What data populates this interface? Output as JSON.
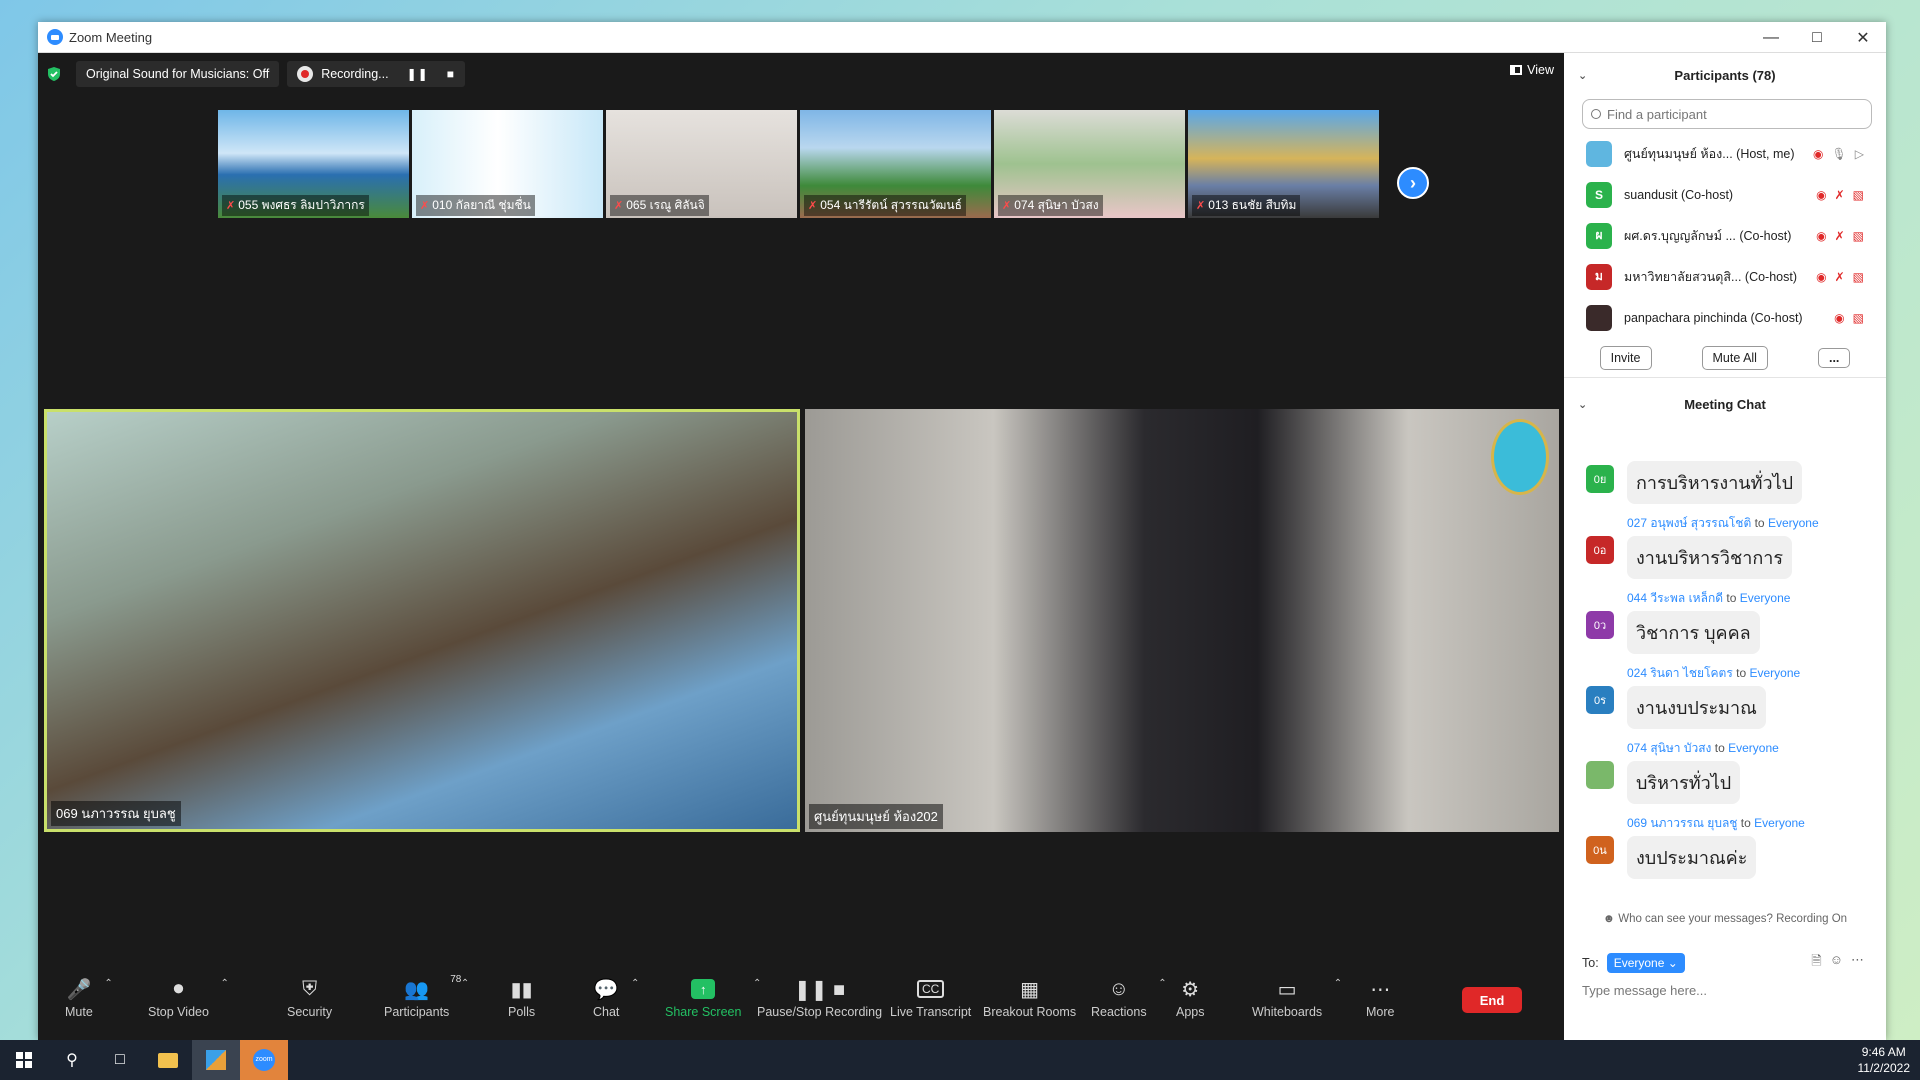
{
  "window": {
    "title": "Zoom Meeting"
  },
  "topbar": {
    "sound_label": "Original Sound for Musicians: Off",
    "recording_label": "Recording...",
    "view_label": "View"
  },
  "thumbnails": [
    {
      "name": "055 พงศธร ลิมปาวิภากร",
      "bg": "linear-gradient(180deg,#6fb6e8 0%,#cfe6f7 40%,#2a6fb0 60%,#4a8a3a 100%)"
    },
    {
      "name": "010 กัลยาณี ชุ่มชื่น",
      "bg": "linear-gradient(90deg,#d8f0fa 0%,#ffffff 45%,#c8e8f8 100%)"
    },
    {
      "name": "065 เรณู ศิลันจิ",
      "bg": "linear-gradient(180deg,#e6e2de 0%,#c9c2bc 100%)"
    },
    {
      "name": "054 นารีรัตน์ สุวรรณวัฒนธ์",
      "bg": "linear-gradient(180deg,#7fb6e6 0%,#b9d7ef 35%,#3e8a3a 70%,#9b6b4e 100%)"
    },
    {
      "name": "074 สุนิษา บัวสง",
      "bg": "linear-gradient(180deg,#dcdcd6 0%,#9ec28f 50%,#e9c6c8 100%)"
    },
    {
      "name": "013 ธนชัย สืบทิม",
      "bg": "linear-gradient(180deg,#5aa7e8 0%,#d6b45a 45%,#6a7fa6 70%,#3a3a3a 100%)"
    }
  ],
  "speaker_left": {
    "name": "069 นภาวรรณ ยุบลชู"
  },
  "speaker_right": {
    "name": "ศูนย์ทุนมนุษย์ ห้อง202"
  },
  "toolbar": {
    "mute": "Mute",
    "stop_video": "Stop Video",
    "security": "Security",
    "participants": "Participants",
    "participants_count": "78",
    "polls": "Polls",
    "chat": "Chat",
    "share_screen": "Share Screen",
    "pause_recording": "Pause/Stop Recording",
    "live_transcript": "Live Transcript",
    "breakout_rooms": "Breakout Rooms",
    "reactions": "Reactions",
    "apps": "Apps",
    "whiteboards": "Whiteboards",
    "more": "More",
    "end": "End"
  },
  "participants": {
    "header": "Participants (78)",
    "search_placeholder": "Find a participant",
    "list": [
      {
        "name": "ศูนย์ทุนมนุษย์ ห้อง... (Host, me)",
        "avatar_text": "",
        "color": "#5fb6e0"
      },
      {
        "name": "suandusit (Co-host)",
        "avatar_text": "S",
        "color": "#2bb24c"
      },
      {
        "name": "ผศ.ดร.บุญญลักษม์ ... (Co-host)",
        "avatar_text": "ผ",
        "color": "#2bb24c"
      },
      {
        "name": "มหาวิทยาลัยสวนดุสิ... (Co-host)",
        "avatar_text": "ม",
        "color": "#c62828"
      },
      {
        "name": "panpachara pinchinda (Co-host)",
        "avatar_text": "",
        "color": "#3a2a2a"
      }
    ],
    "invite": "Invite",
    "mute_all": "Mute All",
    "more": "..."
  },
  "chat": {
    "header": "Meeting Chat",
    "messages": [
      {
        "from": "",
        "to": "",
        "avatar": "0ย",
        "color": "#2bb24c",
        "text": "การบริหารงานทั่วไป"
      },
      {
        "from": "027 อนุพงษ์ สุวรรณโชติ",
        "to": "Everyone",
        "avatar": "0อ",
        "color": "#c62828",
        "text": "งานบริหารวิชาการ"
      },
      {
        "from": "044 วีระพล เหล็กดี",
        "to": "Everyone",
        "avatar": "0ว",
        "color": "#8e3aa8",
        "text": "วิชาการ บุคคล"
      },
      {
        "from": "024 รินดา ไชยโคตร",
        "to": "Everyone",
        "avatar": "0ร",
        "color": "#2a7fc0",
        "text": "งานงบประมาณ"
      },
      {
        "from": "074 สุนิษา บัวสง",
        "to": "Everyone",
        "avatar": "",
        "color": "#7ab86a",
        "text": "บริหารทั่วไป"
      },
      {
        "from": "069 นภาวรรณ ยุบลชู",
        "to": "Everyone",
        "avatar": "0น",
        "color": "#d0621e",
        "text": "งบประมาณค่ะ"
      }
    ],
    "to_word": "to",
    "visibility_note": "Who can see your messages? Recording On",
    "to_label": "To:",
    "to_target": "Everyone",
    "input_placeholder": "Type message here..."
  },
  "taskbar": {
    "time": "9:46 AM",
    "date": "11/2/2022"
  }
}
